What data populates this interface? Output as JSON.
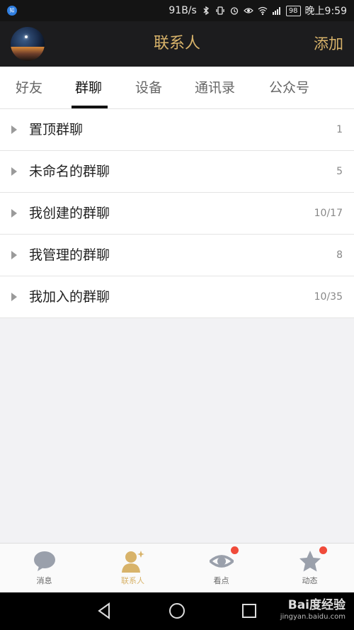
{
  "status_bar": {
    "app_badge": "知",
    "speed": "91B/s",
    "network": "3G/4G",
    "battery": "98",
    "time": "晚上9:59"
  },
  "header": {
    "title": "联系人",
    "add_label": "添加"
  },
  "tabs": [
    {
      "label": "好友",
      "active": false
    },
    {
      "label": "群聊",
      "active": true
    },
    {
      "label": "设备",
      "active": false
    },
    {
      "label": "通讯录",
      "active": false
    },
    {
      "label": "公众号",
      "active": false
    }
  ],
  "groups": [
    {
      "label": "置顶群聊",
      "count": "1"
    },
    {
      "label": "未命名的群聊",
      "count": "5"
    },
    {
      "label": "我创建的群聊",
      "count": "10/17"
    },
    {
      "label": "我管理的群聊",
      "count": "8"
    },
    {
      "label": "我加入的群聊",
      "count": "10/35"
    }
  ],
  "bottom_nav": [
    {
      "label": "消息",
      "icon": "chat-bubble-icon",
      "active": false,
      "badge": false
    },
    {
      "label": "联系人",
      "icon": "contact-person-icon",
      "active": true,
      "badge": false
    },
    {
      "label": "看点",
      "icon": "eye-icon",
      "active": false,
      "badge": true
    },
    {
      "label": "动态",
      "icon": "star-icon",
      "active": false,
      "badge": true
    }
  ],
  "watermark": {
    "brand": "Bai度经验",
    "url": "jingyan.baidu.com"
  },
  "colors": {
    "accent_gold": "#d8b36a",
    "header_bg": "#1c1c1e",
    "badge_red": "#f04b3a"
  }
}
